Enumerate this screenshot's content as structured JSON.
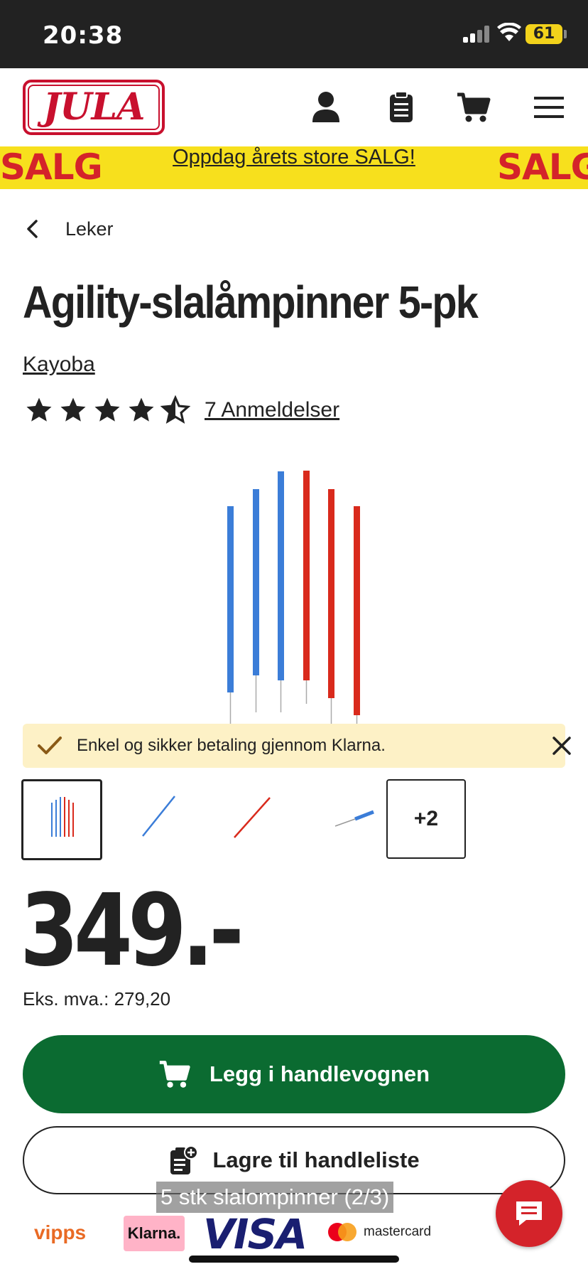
{
  "status_bar": {
    "time": "20:38",
    "battery": "61"
  },
  "header": {
    "logo": "JULA",
    "icons": [
      "account-icon",
      "shopping-list-icon",
      "cart-icon",
      "menu-icon"
    ]
  },
  "sale_banner": {
    "left_text": "SALG",
    "link": "Oppdag årets store SALG!",
    "right_text": "SALG",
    "background": "#f7e01d",
    "accent": "#d4232a"
  },
  "breadcrumb": {
    "label": "Leker"
  },
  "product": {
    "title": "Agility-slalåmpinner 5-pk",
    "brand": "Kayoba",
    "rating": 4.5,
    "rating_max": 5,
    "reviews": "7 Anmeldelser"
  },
  "gallery": {
    "image_alt": "poles",
    "more_label": "+2"
  },
  "klarna_note": {
    "text": "Enkel og sikker betaling gjennom Klarna."
  },
  "price": {
    "value": "349.-",
    "vat": "Eks. mva.: 279,20"
  },
  "actions": {
    "add_to_cart": "Legg i handlevognen",
    "save_list": "Lagre til handleliste"
  },
  "caption": "5 stk slalompinner (2/3)",
  "payments": {
    "vipps": "vipps",
    "klarna": "Klarna.",
    "visa": "VISA",
    "mastercard": "mastercard"
  },
  "colors": {
    "primary_green": "#0b6b31",
    "brand_red": "#c8102e",
    "blue_pole": "#3b7dd8",
    "red_pole": "#d92a1c"
  }
}
